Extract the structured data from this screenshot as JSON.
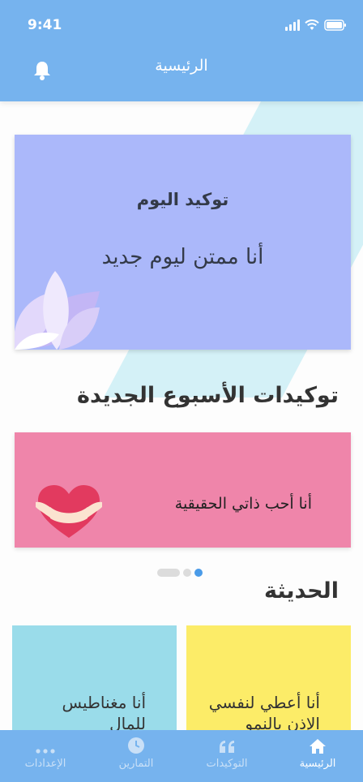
{
  "status_bar": {
    "time": "9:41"
  },
  "header": {
    "title": "الرئيسية",
    "bell_icon": "bell-icon"
  },
  "daily_affirmation": {
    "title": "توكيد اليوم",
    "text": "أنا ممتن ليوم جديد",
    "color": "#abb8fa"
  },
  "weekly_section": {
    "title": "توكيدات الأسبوع الجديدة",
    "card": {
      "text": "أنا أحب ذاتي الحقيقية",
      "color": "#ef85aa"
    },
    "carousel_active_index": 2
  },
  "recent_section": {
    "title": "الحديثة",
    "cards": [
      {
        "text": "أنا أعطي لنفسي الإذن بالنمو",
        "color": "#fcec68"
      },
      {
        "text": "أنا مغناطيس للمال",
        "color": "#9adcea"
      }
    ]
  },
  "tabbar": {
    "items": [
      {
        "label": "الرئيسية",
        "icon": "home-icon",
        "active": true
      },
      {
        "label": "التوكيدات",
        "icon": "quote-icon",
        "active": false
      },
      {
        "label": "التمارين",
        "icon": "clock-icon",
        "active": false
      },
      {
        "label": "الإعدادات",
        "icon": "more-icon",
        "active": false
      }
    ]
  },
  "colors": {
    "header": "#76b3ee",
    "accent": "#4a9be8"
  }
}
